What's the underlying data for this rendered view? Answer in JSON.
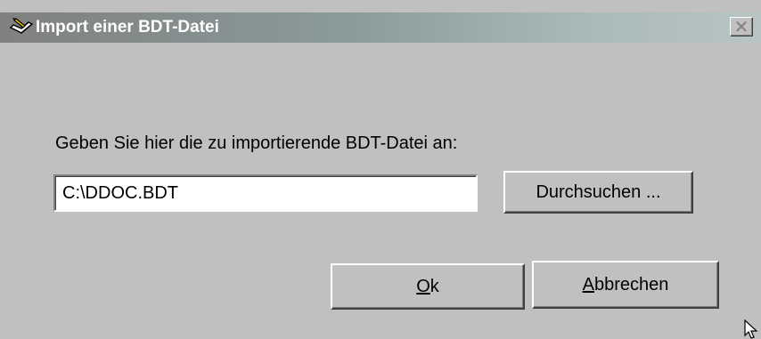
{
  "window": {
    "title": "Import einer BDT-Datei",
    "icon": "pen-writing-icon",
    "close_symbol": "✕"
  },
  "dialog": {
    "prompt": "Geben Sie hier die zu importierende BDT-Datei an:",
    "path_value": "C:\\DDOC.BDT",
    "browse_label": "Durchsuchen ...",
    "ok_mnemonic": "O",
    "ok_rest": "k",
    "cancel_mnemonic": "A",
    "cancel_rest": "bbrechen"
  },
  "colors": {
    "dialog_background": "#c0c0c0",
    "titlebar_start": "#808080",
    "titlebar_end": "#b8c4c4",
    "title_text": "#ffffff"
  }
}
